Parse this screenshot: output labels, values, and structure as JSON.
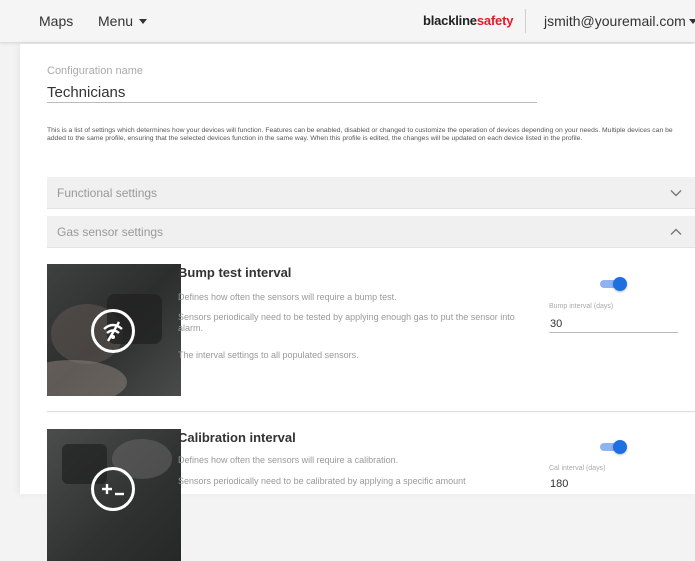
{
  "nav": {
    "maps": "Maps",
    "menu": "Menu",
    "brand_part1": "blackline",
    "brand_part2": "safety",
    "user_email": "jsmith@youremail.com"
  },
  "config": {
    "label": "Configuration name",
    "value": "Technicians",
    "description": "This is a list of settings which determines how your devices will function. Features can be enabled, disabled or changed to customize the operation of devices depending on your needs. Multiple devices can be added to the same profile, ensuring that the selected devices function in the same way. When this profile is edited, the changes will be updated on each device listed in the profile."
  },
  "sections": {
    "functional": {
      "label": "Functional settings",
      "expanded": false
    },
    "gas_sensor": {
      "label": "Gas sensor settings",
      "expanded": true
    }
  },
  "bump_test": {
    "title": "Bump test interval",
    "line1": "Defines how often the sensors will require a bump test.",
    "line2": "Sensors periodically need to be tested by applying enough gas to put the sensor into alarm.",
    "line3": "The interval settings to all populated sensors.",
    "toggle_on": true,
    "field_label": "Bump interval (days)",
    "field_value": "30"
  },
  "calibration": {
    "title": "Calibration interval",
    "line1": "Defines how often the sensors will require a calibration.",
    "line2": "Sensors periodically need to be calibrated by applying a specific amount",
    "toggle_on": true,
    "field_label": "Cal interval (days)",
    "field_value": "180"
  },
  "colors": {
    "accent": "#1e6fe0",
    "brand_red": "#e31b23"
  },
  "icons": {
    "bump": "no-gas-icon",
    "calibration": "calibration-icon",
    "collapsed": "chevron-down-icon",
    "expanded": "chevron-up-icon"
  }
}
